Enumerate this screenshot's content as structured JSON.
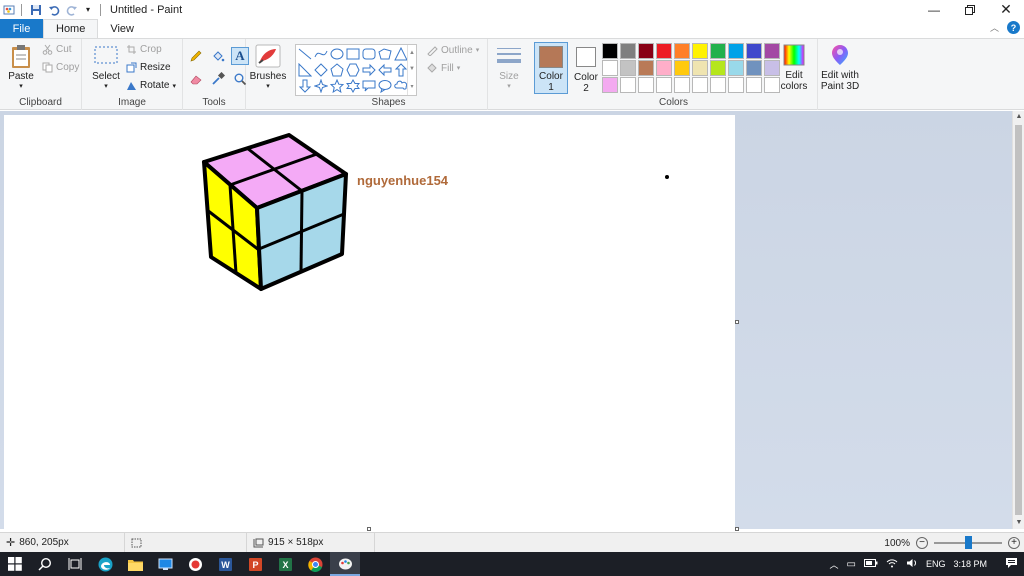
{
  "window": {
    "title": "Untitled - Paint",
    "controls": [
      "minimize",
      "maximize",
      "close"
    ]
  },
  "tabs": {
    "file": "File",
    "home": "Home",
    "view": "View"
  },
  "ribbon": {
    "clipboard": {
      "label": "Clipboard",
      "paste": "Paste",
      "cut": "Cut",
      "copy": "Copy"
    },
    "image": {
      "label": "Image",
      "select": "Select",
      "crop": "Crop",
      "resize": "Resize",
      "rotate": "Rotate"
    },
    "tools": {
      "label": "Tools"
    },
    "brushes": {
      "label": "Brushes"
    },
    "shapes": {
      "label": "Shapes",
      "outline": "Outline",
      "fill": "Fill"
    },
    "size": {
      "label": "Size"
    },
    "colors": {
      "label": "Colors",
      "color1": {
        "line1": "Color",
        "line2": "1",
        "value": "#b57857"
      },
      "color2": {
        "line1": "Color",
        "line2": "2",
        "value": "#ffffff"
      },
      "edit_colors": {
        "line1": "Edit",
        "line2": "colors"
      },
      "edit_3d": {
        "line1": "Edit with",
        "line2": "Paint 3D"
      },
      "palette": [
        "#000000",
        "#7f7f7f",
        "#880015",
        "#ed1c24",
        "#ff7f27",
        "#fff200",
        "#22b14c",
        "#00a2e8",
        "#3f48cc",
        "#a349a4",
        "#ffffff",
        "#c3c3c3",
        "#b97a57",
        "#ffaec9",
        "#ffc90e",
        "#efe4b0",
        "#b5e61d",
        "#99d9ea",
        "#7092be",
        "#c8bfe7",
        "#f3aaf0",
        "#ffffff",
        "#ffffff",
        "#ffffff",
        "#ffffff",
        "#ffffff",
        "#ffffff",
        "#ffffff",
        "#ffffff",
        "#ffffff"
      ]
    }
  },
  "canvas": {
    "username": "nguyenhue154",
    "cube_colors": {
      "top": "#f4aaf6",
      "left": "#ffff00",
      "right": "#a6d8ea",
      "outline": "#000000"
    }
  },
  "status": {
    "cursor_pos": "860, 205px",
    "canvas_size": "915 × 518px",
    "zoom": "100%"
  },
  "taskbar": {
    "tray": {
      "language": "ENG",
      "time": "3:18 PM"
    }
  }
}
